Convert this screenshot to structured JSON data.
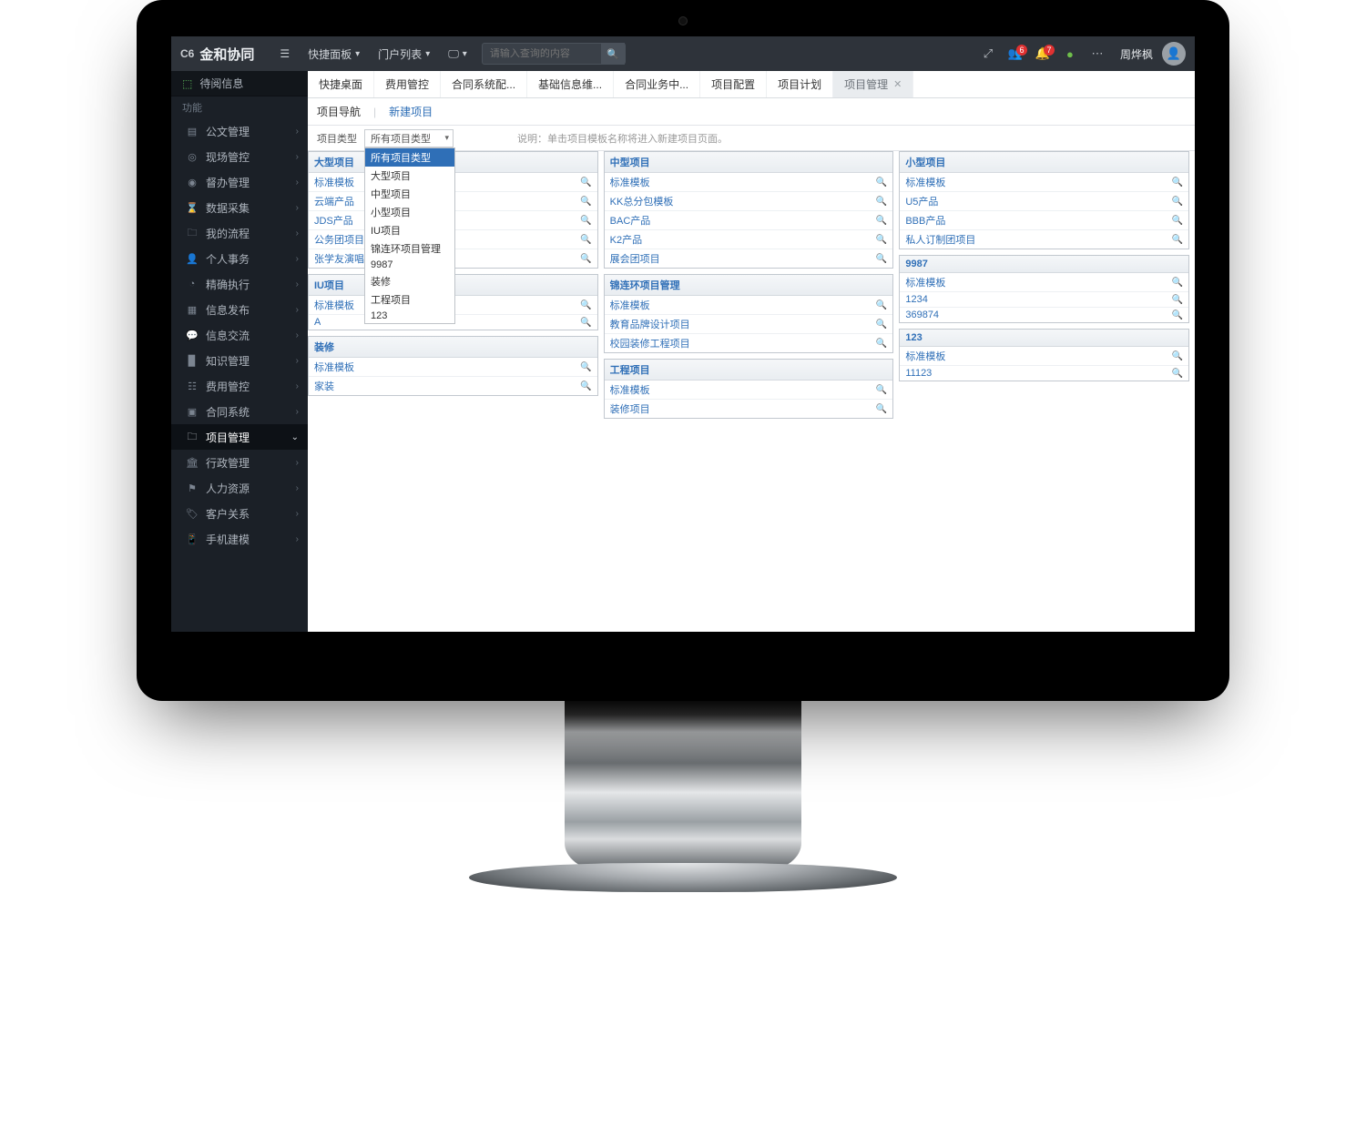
{
  "brand": {
    "c6": "C6",
    "name": "金和协同"
  },
  "topbar": {
    "quick_panel": "快捷面板",
    "portal_list": "门户列表",
    "search_placeholder": "请输入查询的内容",
    "username": "周烨枫",
    "badge_users": "6",
    "badge_bell": "7"
  },
  "sidebar_top": {
    "label": "待阅信息"
  },
  "sidebar_header": "功能",
  "sidebar": [
    {
      "icon": "▤",
      "label": "公文管理"
    },
    {
      "icon": "◎",
      "label": "现场管控"
    },
    {
      "icon": "◉",
      "label": "督办管理"
    },
    {
      "icon": "⌛",
      "label": "数据采集"
    },
    {
      "icon": "🗀",
      "label": "我的流程"
    },
    {
      "icon": "👤",
      "label": "个人事务"
    },
    {
      "icon": "◔",
      "label": "精确执行"
    },
    {
      "icon": "▦",
      "label": "信息发布"
    },
    {
      "icon": "💬",
      "label": "信息交流"
    },
    {
      "icon": "▉",
      "label": "知识管理"
    },
    {
      "icon": "☷",
      "label": "费用管控"
    },
    {
      "icon": "▣",
      "label": "合同系统"
    },
    {
      "icon": "🗀",
      "label": "项目管理",
      "active": true,
      "caret": "⌄"
    },
    {
      "icon": "🏛",
      "label": "行政管理"
    },
    {
      "icon": "⚑",
      "label": "人力资源"
    },
    {
      "icon": "🏷",
      "label": "客户关系"
    },
    {
      "icon": "📱",
      "label": "手机建模"
    }
  ],
  "tabs": [
    {
      "label": "快捷桌面"
    },
    {
      "label": "费用管控"
    },
    {
      "label": "合同系统配..."
    },
    {
      "label": "基础信息维..."
    },
    {
      "label": "合同业务中..."
    },
    {
      "label": "项目配置"
    },
    {
      "label": "项目计划"
    },
    {
      "label": "项目管理",
      "active": true,
      "close": "✕"
    }
  ],
  "subtabs": {
    "nav": "项目导航",
    "sep": "|",
    "new": "新建项目"
  },
  "filter": {
    "label": "项目类型",
    "selected": "所有项目类型",
    "hint": "说明：单击项目模板名称将进入新建项目页面。",
    "options": [
      "所有项目类型",
      "大型项目",
      "中型项目",
      "小型项目",
      "IU项目",
      "锦连环项目管理",
      "9987",
      "装修",
      "工程项目",
      "123"
    ]
  },
  "columns": [
    [
      {
        "title": "大型项目",
        "rows": [
          "标准模板",
          "云端产品",
          "JDS产品",
          "公务团项目",
          "张学友演唱会"
        ]
      },
      {
        "title": "IU项目",
        "rows": [
          "标准模板",
          "A"
        ]
      },
      {
        "title": "装修",
        "rows": [
          "标准模板",
          "家装"
        ]
      }
    ],
    [
      {
        "title": "中型项目",
        "rows": [
          "标准模板",
          "KK总分包模板",
          "BAC产品",
          "K2产品",
          "展会团项目"
        ]
      },
      {
        "title": "锦连环项目管理",
        "rows": [
          "标准模板",
          "教育品牌设计项目",
          "校园装修工程项目"
        ]
      },
      {
        "title": "工程项目",
        "rows": [
          "标准模板",
          "装修项目"
        ]
      }
    ],
    [
      {
        "title": "小型项目",
        "rows": [
          "标准模板",
          "U5产品",
          "BBB产品",
          "私人订制团项目"
        ]
      },
      {
        "title": "9987",
        "rows": [
          "标准模板",
          "1234",
          "369874"
        ]
      },
      {
        "title": "123",
        "rows": [
          "标准模板",
          "11123"
        ]
      }
    ]
  ],
  "mag_icon": "🔍"
}
